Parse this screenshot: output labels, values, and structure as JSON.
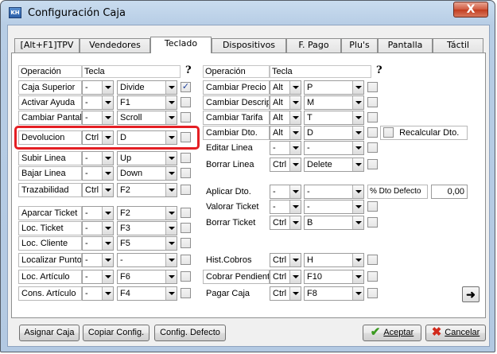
{
  "window": {
    "title": "Configuración Caja",
    "icon": "KH",
    "close": "X"
  },
  "tabs": [
    {
      "label": "[Alt+F1]TPV"
    },
    {
      "label": "Vendedores"
    },
    {
      "label": "Teclado",
      "active": true
    },
    {
      "label": "Dispositivos"
    },
    {
      "label": "F. Pago"
    },
    {
      "label": "Plu's"
    },
    {
      "label": "Pantalla"
    },
    {
      "label": "Táctil"
    }
  ],
  "left": {
    "header": {
      "operation": "Operación",
      "key": "Tecla",
      "help": "?"
    },
    "rows": [
      {
        "op": "Caja Superior",
        "mod": "-",
        "key": "Divide",
        "checked": true
      },
      {
        "op": "Activar Ayuda",
        "mod": "-",
        "key": "F1",
        "checked": false
      },
      {
        "op": "Cambiar Pantalla",
        "mod": "-",
        "key": "Scroll",
        "checked": false
      },
      {
        "op": "Devolucion",
        "mod": "Ctrl",
        "key": "D",
        "checked": false,
        "highlighted": true
      },
      {
        "op": "Subir Linea",
        "mod": "-",
        "key": "Up",
        "checked": false
      },
      {
        "op": "Bajar Linea",
        "mod": "-",
        "key": "Down",
        "checked": false
      },
      {
        "op": "Trazabilidad",
        "mod": "Ctrl",
        "key": "F2",
        "checked": false
      },
      {
        "op": "Aparcar Ticket",
        "mod": "-",
        "key": "F2",
        "checked": false
      },
      {
        "op": "Loc. Ticket",
        "mod": "-",
        "key": "F3",
        "checked": false
      },
      {
        "op": "Loc. Cliente",
        "mod": "-",
        "key": "F5",
        "checked": false
      },
      {
        "op": "Localizar Puntos",
        "mod": "-",
        "key": "-",
        "checked": false
      },
      {
        "op": "Loc. Artículo",
        "mod": "-",
        "key": "F6",
        "checked": false
      },
      {
        "op": "Cons. Artículo",
        "mod": "-",
        "key": "F4",
        "checked": false
      }
    ]
  },
  "right": {
    "header": {
      "operation": "Operación",
      "key": "Tecla",
      "help": "?"
    },
    "rows": [
      {
        "op": "Cambiar Precio",
        "mod": "Alt",
        "key": "P",
        "checked": false
      },
      {
        "op": "Cambiar Descrip.",
        "mod": "Alt",
        "key": "M",
        "checked": false
      },
      {
        "op": "Cambiar Tarifa",
        "mod": "Alt",
        "key": "T",
        "checked": false
      },
      {
        "op": "Cambiar Dto.",
        "mod": "Alt",
        "key": "D",
        "checked": false
      },
      {
        "op": "Editar Linea",
        "mod": "-",
        "key": "-",
        "checked": false
      },
      {
        "op": "Borrar Linea",
        "mod": "Ctrl",
        "key": "Delete",
        "checked": false
      },
      {
        "op": "Aplicar Dto.",
        "mod": "-",
        "key": "-",
        "checked": false
      },
      {
        "op": "Valorar Ticket",
        "mod": "-",
        "key": "-",
        "checked": false
      },
      {
        "op": "Borrar Ticket",
        "mod": "Ctrl",
        "key": "B",
        "checked": false
      },
      {
        "op": "Hist.Cobros",
        "mod": "Ctrl",
        "key": "H",
        "checked": false
      },
      {
        "op": "Cobrar Pendiente",
        "mod": "Ctrl",
        "key": "F10",
        "checked": false
      },
      {
        "op": "Pagar Caja",
        "mod": "Ctrl",
        "key": "F8",
        "checked": false
      }
    ],
    "recalc_label": "Recalcular Dto.",
    "dto_defecto_label": "% Dto Defecto",
    "dto_defecto_value": "0,00",
    "next_icon": "arrow-right-icon"
  },
  "buttons": {
    "assign": "Asignar Caja",
    "copy": "Copiar Config.",
    "default": "Config. Defecto",
    "accept": "Aceptar",
    "cancel": "Cancelar"
  },
  "colors": {
    "highlight": "#e41f24",
    "accept_icon": "#3a9a1f",
    "cancel_icon": "#d12a1c"
  }
}
